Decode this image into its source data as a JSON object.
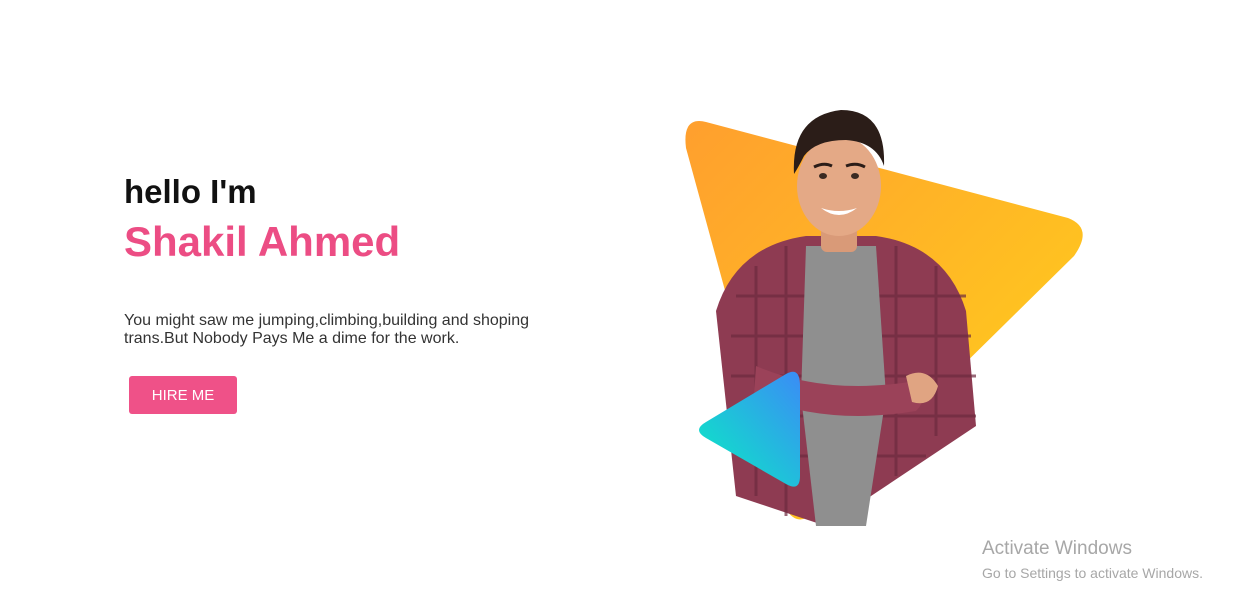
{
  "hero": {
    "greeting": "hello I'm",
    "name": "Shakil Ahmed",
    "bio_line1": "You might saw me jumping,climbing,building and shoping",
    "bio_line2": "trans.But Nobody Pays Me a dime for the work.",
    "cta_label": "HIRE ME"
  },
  "colors": {
    "accent": "#ec4d84",
    "button": "#ef5188",
    "triangle_orange": "#ff9f2e",
    "triangle_yellow": "#ffd31a",
    "play_cyan": "#08eec2",
    "play_blue": "#3b8cf6"
  },
  "portrait": {
    "icon": "portrait-illustration"
  },
  "watermark": {
    "title": "Activate Windows",
    "subtitle": "Go to Settings to activate Windows."
  }
}
